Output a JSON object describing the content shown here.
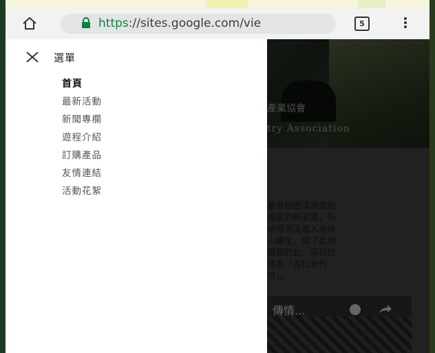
{
  "browser": {
    "url_scheme": "https",
    "url_rest": "://sites.google.com/vie",
    "tab_count": "5",
    "icons": {
      "home": "home-icon",
      "lock": "lock-icon",
      "tabs": "tabs-icon",
      "menu": "overflow-menu-icon"
    }
  },
  "drawer": {
    "title": "選單",
    "close_icon": "close-icon",
    "items": [
      {
        "label": "首頁",
        "active": true
      },
      {
        "label": "最新活動",
        "active": false
      },
      {
        "label": "新聞專欄",
        "active": false
      },
      {
        "label": "遊程介紹",
        "active": false
      },
      {
        "label": "訂購產品",
        "active": false
      },
      {
        "label": "友情連結",
        "active": false
      },
      {
        "label": "活動花絮",
        "active": false
      }
    ]
  },
  "page": {
    "hero_title": "產業協會",
    "hero_subtitle": "try Association",
    "body_lines": [
      "著秀姑巒溪溯源而",
      "遷居的新家園，先",
      "始得溯溪進入海岸",
      "山維生，成了此地",
      "根植於此、深耕於",
      "落為「吉拉米代",
      "地」。"
    ],
    "media_title": "傳情..."
  },
  "colors": {
    "secure_green": "#0b8043",
    "scrim": "rgba(0,0,0,0.45)"
  }
}
